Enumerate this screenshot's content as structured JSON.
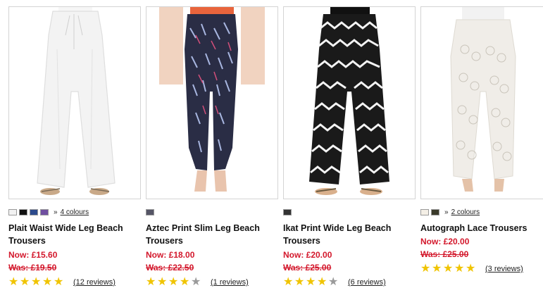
{
  "products": [
    {
      "title": "Plait Waist Wide Leg Beach Trousers",
      "now": "Now: £15.60",
      "was": "Was: £19.50",
      "swatches": [
        "#f2f2f2",
        "#111111",
        "#2c4a8c",
        "#6f4fa0"
      ],
      "colours_link": "4 colours",
      "stars": 5,
      "reviews": "(12 reviews)",
      "image_icon": "white-wide-leg-trousers-image"
    },
    {
      "title": "Aztec Print Slim Leg Beach Trousers",
      "now": "Now: £18.00",
      "was": "Was: £22.50",
      "swatches": [
        "#555566"
      ],
      "colours_link": "",
      "stars": 4,
      "reviews": "(1 reviews)",
      "image_icon": "aztec-print-trousers-image"
    },
    {
      "title": "Ikat Print Wide Leg Beach Trousers",
      "now": "Now: £20.00",
      "was": "Was: £25.00",
      "swatches": [
        "#333333"
      ],
      "colours_link": "",
      "stars": 4,
      "reviews": "(6 reviews)",
      "image_icon": "ikat-print-trousers-image"
    },
    {
      "title": "Autograph Lace Trousers",
      "now": "Now: £20.00",
      "was": "Was: £25.00",
      "swatches": [
        "#f4efe6",
        "#3a3a2a"
      ],
      "colours_link": "2 colours",
      "stars": 5,
      "reviews": "(3 reviews)",
      "image_icon": "lace-trousers-image"
    }
  ],
  "colors": {
    "price": "#d3172b",
    "star_on": "#f0c400",
    "star_off": "#9a9a9a"
  }
}
